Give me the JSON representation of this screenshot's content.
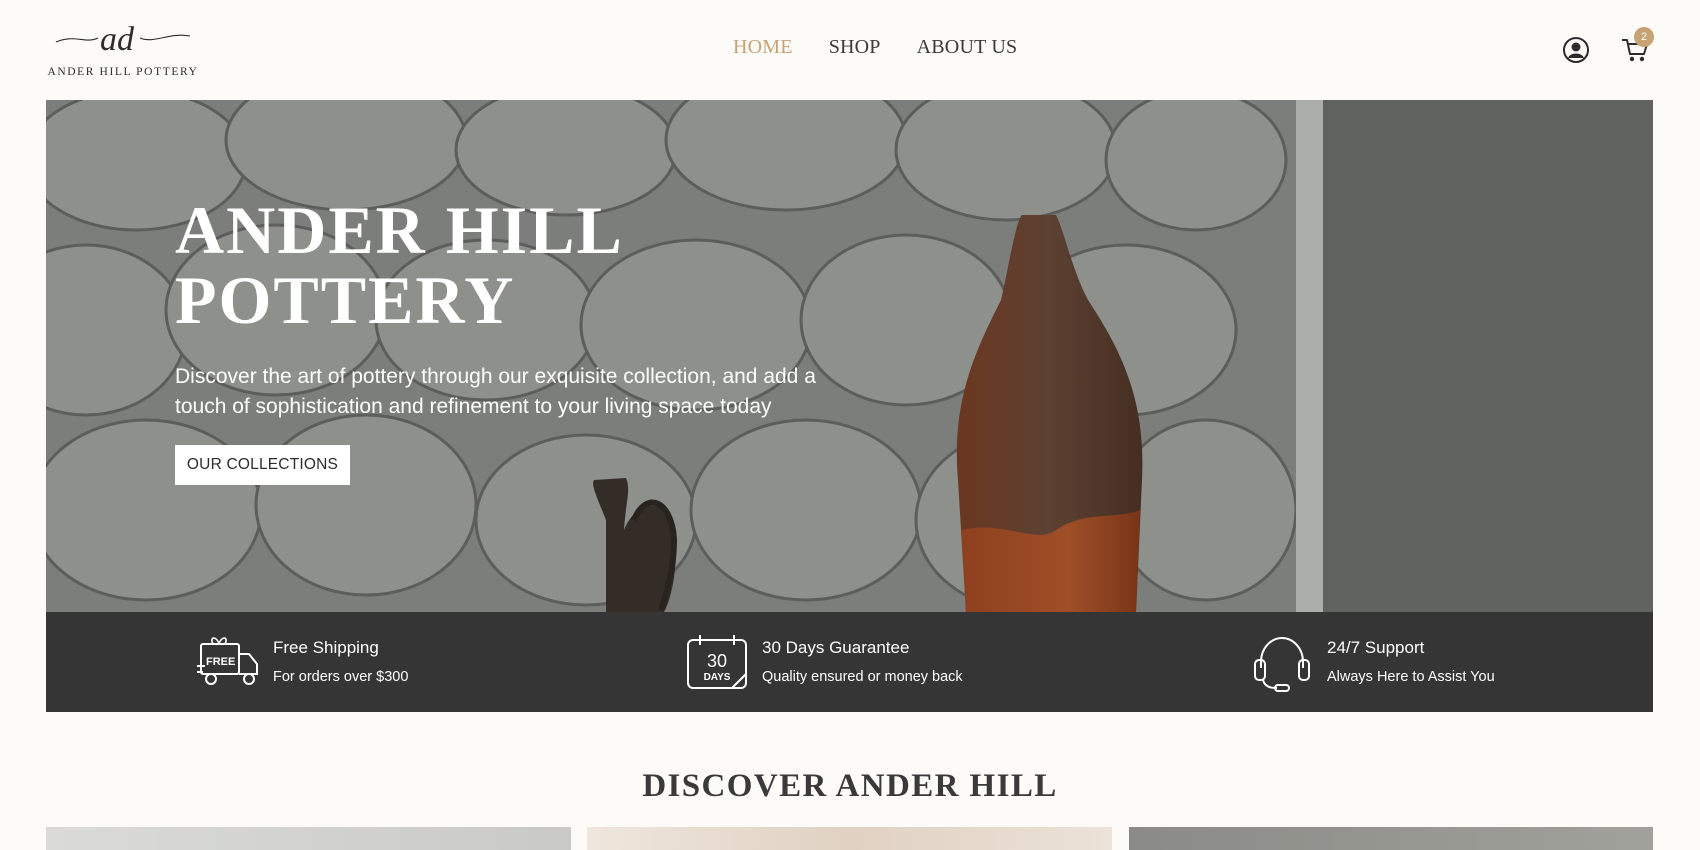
{
  "brand": {
    "monogram": "ad",
    "name": "ANDER HILL POTTERY"
  },
  "nav": {
    "items": [
      {
        "label": "HOME",
        "active": true
      },
      {
        "label": "SHOP",
        "active": false
      },
      {
        "label": "ABOUT US",
        "active": false
      }
    ]
  },
  "header": {
    "user_icon": "user-circle-icon",
    "cart_icon": "cart-icon",
    "cart_count": "2"
  },
  "hero": {
    "title_line1": "ANDER HILL",
    "title_line2": "POTTERY",
    "description": "Discover the art of pottery through our exquisite collection, and add a touch of sophistication and refinement to your living space today",
    "cta_label": "OUR COLLECTIONS"
  },
  "features": [
    {
      "icon": "free-shipping-truck-icon",
      "icon_text": "FREE",
      "title": "Free Shipping",
      "subtitle": "For orders over $300"
    },
    {
      "icon": "calendar-30-days-icon",
      "icon_number": "30",
      "icon_text": "DAYS",
      "title": "30 Days Guarantee",
      "subtitle": "Quality ensured or money back"
    },
    {
      "icon": "headset-support-icon",
      "title": "24/7 Support",
      "subtitle": "Always Here to Assist You"
    }
  ],
  "discover": {
    "title": "DISCOVER ANDER HILL"
  },
  "colors": {
    "accent": "#c7a374",
    "dark_band": "#353535",
    "background": "#fcfbf8",
    "text": "#2c2c2c"
  }
}
